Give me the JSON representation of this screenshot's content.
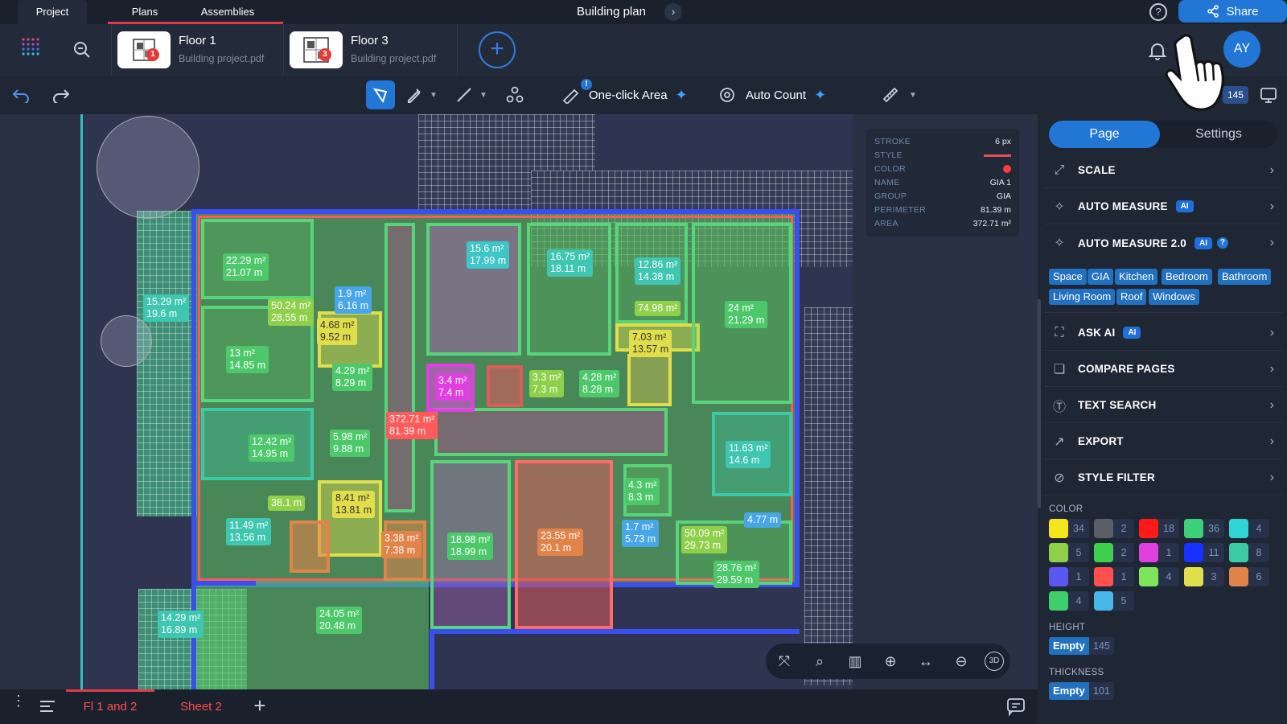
{
  "topnav": {
    "tabs": [
      "Project",
      "Plans",
      "Assemblies"
    ],
    "active_tab": "Plans",
    "title": "Building plan",
    "share_label": "Share",
    "avatar": "AY"
  },
  "files": [
    {
      "name": "Floor 1",
      "source": "Building project.pdf",
      "badge": "1"
    },
    {
      "name": "Floor 3",
      "source": "Building project.pdf",
      "badge": "3"
    }
  ],
  "toolbar": {
    "one_click_area": "One-click Area",
    "auto_count": "Auto Count",
    "count_badge": "145"
  },
  "props": {
    "rows": [
      {
        "label": "STROKE",
        "value": "6 px"
      },
      {
        "label": "STYLE",
        "value": ""
      },
      {
        "label": "COLOR",
        "value": ""
      },
      {
        "label": "NAME",
        "value": "GIA 1"
      },
      {
        "label": "GROUP",
        "value": "GIA"
      },
      {
        "label": "PERIMETER",
        "value": "81.39 m"
      },
      {
        "label": "AREA",
        "value": "372.71 m²"
      }
    ],
    "style_color": "#e05252",
    "color_dot": "#ff3b3b"
  },
  "labels": [
    {
      "a": "22.29 m²",
      "b": "21.07 m"
    },
    {
      "a": "15.6 m²",
      "b": "17.99 m"
    },
    {
      "a": "16.75 m²",
      "b": "18.11 m"
    },
    {
      "a": "12.86 m²",
      "b": "14.38 m"
    },
    {
      "a": "1.9 m²",
      "b": "6.16 m"
    },
    {
      "a": "50.24 m²",
      "b": "28.55 m"
    },
    {
      "a": "15.29 m²",
      "b": "19.6 m"
    },
    {
      "a": "4.68 m²",
      "b": "9.52 m"
    },
    {
      "a": "74.98 m²",
      "b": ""
    },
    {
      "a": "24 m²",
      "b": "21.29 m"
    },
    {
      "a": "7.03 m²",
      "b": "13.57 m"
    },
    {
      "a": "13 m²",
      "b": "14.85 m"
    },
    {
      "a": "4.29 m²",
      "b": "8.29 m"
    },
    {
      "a": "3.4 m²",
      "b": "7.4 m"
    },
    {
      "a": "3.3 m²",
      "b": "7.3 m"
    },
    {
      "a": "4.28 m²",
      "b": "8.28 m"
    },
    {
      "a": "372.71 m²",
      "b": "81.39 m"
    },
    {
      "a": "12.42 m²",
      "b": "14.95 m"
    },
    {
      "a": "5.98 m²",
      "b": "9.88 m"
    },
    {
      "a": "11.63 m²",
      "b": "14.6 m"
    },
    {
      "a": "38.1 m",
      "b": ""
    },
    {
      "a": "4.3 m²",
      "b": "8.3 m"
    },
    {
      "a": "8.41 m²",
      "b": "13.81 m"
    },
    {
      "a": "4.77 m",
      "b": ""
    },
    {
      "a": "11.49 m²",
      "b": "13.56 m"
    },
    {
      "a": "1.7 m²",
      "b": "5.73 m"
    },
    {
      "a": "3.38 m²",
      "b": "7.38 m"
    },
    {
      "a": "18.98 m²",
      "b": "18.99 m"
    },
    {
      "a": "23.55 m²",
      "b": "20.1 m"
    },
    {
      "a": "50.09 m²",
      "b": "29.73 m"
    },
    {
      "a": "28.76 m²",
      "b": "29.59 m"
    },
    {
      "a": "14.29 m²",
      "b": "16.89 m"
    },
    {
      "a": "24.05 m²",
      "b": "20.48 m"
    }
  ],
  "panel": {
    "tabs": [
      "Page",
      "Settings"
    ],
    "rows": [
      "SCALE",
      "AUTO MEASURE",
      "AUTO MEASURE 2.0",
      "ASK AI",
      "COMPARE PAGES",
      "TEXT SEARCH",
      "EXPORT",
      "STYLE FILTER"
    ],
    "ai_tag": "AI",
    "tags": [
      "Space",
      "GIA",
      "Kitchen",
      "Bedroom",
      "Bathroom",
      "Living Room",
      "Roof",
      "Windows"
    ],
    "color_label": "COLOR",
    "colors": [
      {
        "hex": "#f5e61c",
        "count": "34"
      },
      {
        "hex": "#5a5f66",
        "count": "2"
      },
      {
        "hex": "#ff1a1a",
        "count": "18"
      },
      {
        "hex": "#3ecf7a",
        "count": "36"
      },
      {
        "hex": "#2fd4d4",
        "count": "4"
      },
      {
        "hex": "#8ed04a",
        "count": "5"
      },
      {
        "hex": "#3fcf4f",
        "count": "2"
      },
      {
        "hex": "#e040e0",
        "count": "1"
      },
      {
        "hex": "#1530ff",
        "count": "11"
      },
      {
        "hex": "#3bc9a6",
        "count": "8"
      },
      {
        "hex": "#5a58f0",
        "count": "1"
      },
      {
        "hex": "#ff4f4f",
        "count": "1"
      },
      {
        "hex": "#7ee55a",
        "count": "4"
      },
      {
        "hex": "#e1de4c",
        "count": "3"
      },
      {
        "hex": "#e0844a",
        "count": "6"
      },
      {
        "hex": "#3ccf6a",
        "count": "4"
      },
      {
        "hex": "#47b6e8",
        "count": "5"
      }
    ],
    "height_label": "HEIGHT",
    "height_chip": "Empty",
    "height_count": "145",
    "thickness_label": "THICKNESS",
    "thickness_chip": "Empty",
    "thickness_count": "101"
  },
  "bottom": {
    "tabs": [
      "Fl 1 and 2",
      "Sheet 2"
    ],
    "active_tab": "Fl 1 and 2"
  }
}
